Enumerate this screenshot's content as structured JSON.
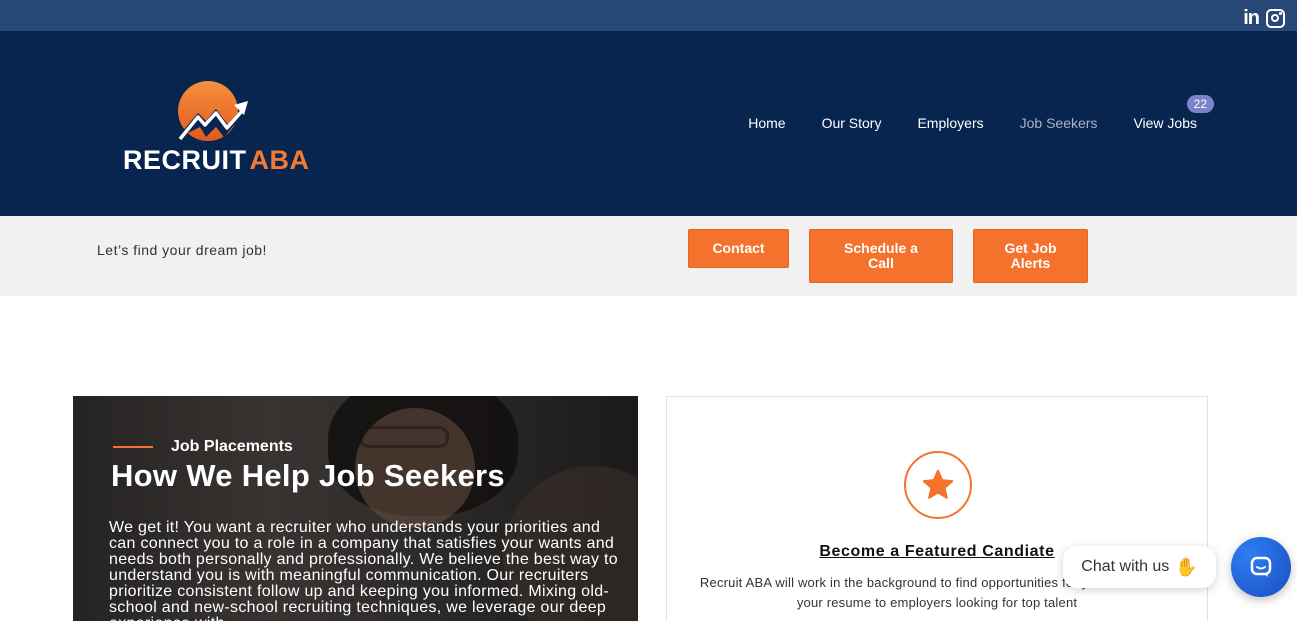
{
  "social": {
    "linkedin_label": "in"
  },
  "logo": {
    "text_main": "RECRUIT",
    "text_accent": "ABA"
  },
  "nav": {
    "items": [
      {
        "label": "Home"
      },
      {
        "label": "Our Story"
      },
      {
        "label": "Employers"
      },
      {
        "label": "Job Seekers",
        "active": true
      },
      {
        "label": "View Jobs"
      }
    ],
    "jobs_badge": "22"
  },
  "subbar": {
    "tagline": "Let’s find your dream job!",
    "contact_label": "Contact",
    "schedule_label": "Schedule a Call",
    "alerts_label": "Get Job Alerts"
  },
  "left_card": {
    "eyebrow": "Job Placements",
    "title": "How We Help Job Seekers",
    "body": "We get it! You want a recruiter who understands your priorities and can connect you to a role in a company that satisfies your wants and needs both personally and professionally. We believe the best way to understand you is with meaningful communication. Our recruiters prioritize consistent follow up and keeping you informed. Mixing old-school and new-school recruiting techniques, we leverage our deep experience with"
  },
  "right_card": {
    "title": "Become a Featured Candiate",
    "body": "Recruit ABA will work in the background to find opportunities for you and market your resume to employers looking for top talent"
  },
  "chat": {
    "bubble_text": "Chat with us"
  },
  "colors": {
    "topbar": "#284878",
    "header": "#07254f",
    "accent": "#f5722d",
    "subbar": "#f1f1f1",
    "chat_button": "#2f7df4"
  }
}
